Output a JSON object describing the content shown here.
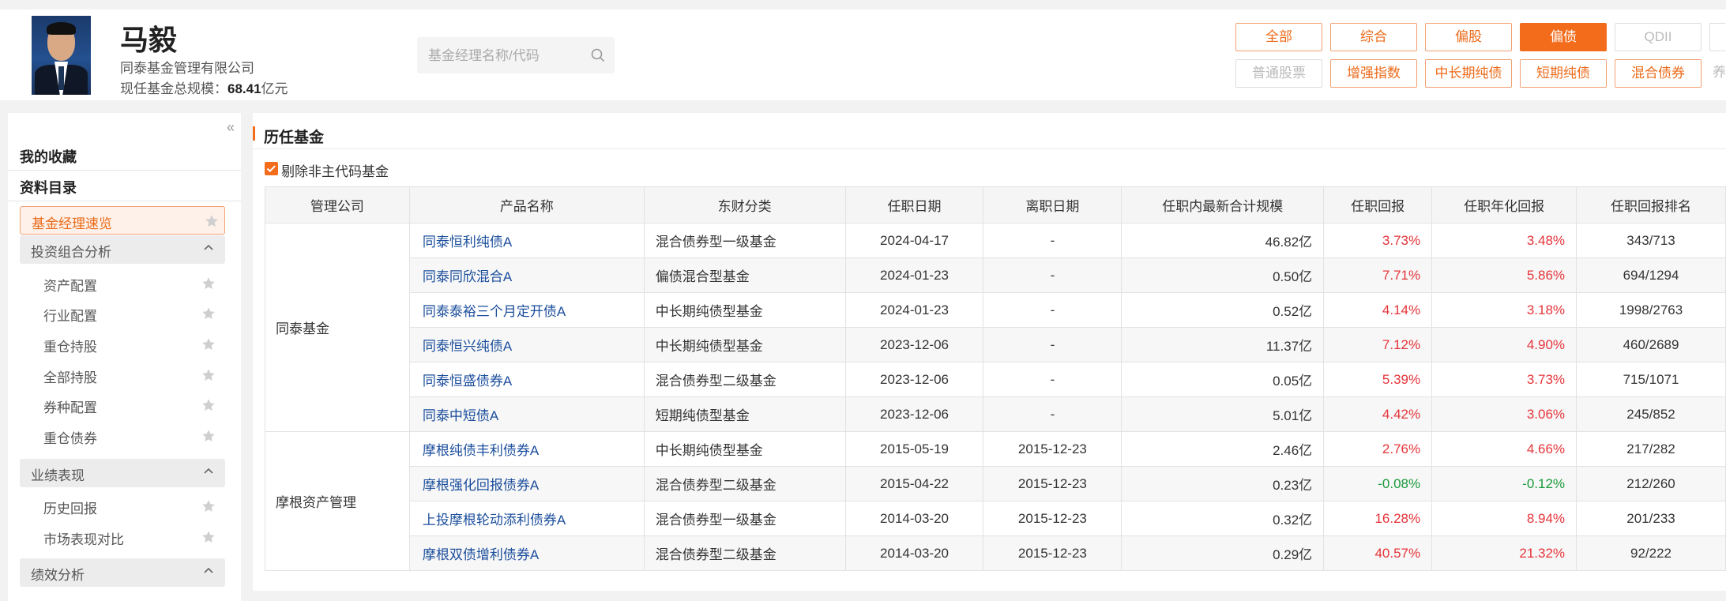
{
  "manager": {
    "name": "马毅",
    "company": "同泰基金管理有限公司",
    "scale_label": "现任基金总规模：",
    "scale_value": "68.41",
    "scale_unit": "亿元"
  },
  "search": {
    "placeholder": "基金经理名称/代码"
  },
  "filters": {
    "row1": [
      "全部",
      "综合",
      "偏股",
      "偏债",
      "QDII"
    ],
    "row2": [
      "普通股票",
      "增强指数",
      "中长期纯债",
      "短期纯债",
      "混合债券",
      "养"
    ],
    "active": "偏债",
    "disabled": [
      "QDII",
      "普通股票"
    ]
  },
  "sidebar": {
    "favorites": "我的收藏",
    "catalog": "资料目录",
    "active_item": "基金经理速览",
    "groups": [
      {
        "label": "投资组合分析",
        "items": [
          "资产配置",
          "行业配置",
          "重仓持股",
          "全部持股",
          "券种配置",
          "重仓债券"
        ]
      },
      {
        "label": "业绩表现",
        "items": [
          "历史回报",
          "市场表现对比"
        ]
      },
      {
        "label": "绩效分析",
        "items": []
      }
    ]
  },
  "main": {
    "title": "历任基金",
    "checkbox_label": "剔除非主代码基金",
    "columns": [
      "管理公司",
      "产品名称",
      "东财分类",
      "任职日期",
      "离职日期",
      "任职内最新合计规模",
      "任职回报",
      "任职年化回报",
      "任职回报排名"
    ],
    "companies": [
      {
        "name": "同泰基金",
        "rows": 6
      },
      {
        "name": "摩根资产管理",
        "rows": 4
      }
    ],
    "rows": [
      {
        "name": "同泰恒利纯债A",
        "category": "混合债券型一级基金",
        "start": "2024-04-17",
        "end": "-",
        "scale": "46.82亿",
        "ret": "3.73%",
        "ann": "3.48%",
        "rank": "343/713"
      },
      {
        "name": "同泰同欣混合A",
        "category": "偏债混合型基金",
        "start": "2024-01-23",
        "end": "-",
        "scale": "0.50亿",
        "ret": "7.71%",
        "ann": "5.86%",
        "rank": "694/1294"
      },
      {
        "name": "同泰泰裕三个月定开债A",
        "category": "中长期纯债型基金",
        "start": "2024-01-23",
        "end": "-",
        "scale": "0.52亿",
        "ret": "4.14%",
        "ann": "3.18%",
        "rank": "1998/2763"
      },
      {
        "name": "同泰恒兴纯债A",
        "category": "中长期纯债型基金",
        "start": "2023-12-06",
        "end": "-",
        "scale": "11.37亿",
        "ret": "7.12%",
        "ann": "4.90%",
        "rank": "460/2689"
      },
      {
        "name": "同泰恒盛债券A",
        "category": "混合债券型二级基金",
        "start": "2023-12-06",
        "end": "-",
        "scale": "0.05亿",
        "ret": "5.39%",
        "ann": "3.73%",
        "rank": "715/1071"
      },
      {
        "name": "同泰中短债A",
        "category": "短期纯债型基金",
        "start": "2023-12-06",
        "end": "-",
        "scale": "5.01亿",
        "ret": "4.42%",
        "ann": "3.06%",
        "rank": "245/852"
      },
      {
        "name": "摩根纯债丰利债券A",
        "category": "中长期纯债型基金",
        "start": "2015-05-19",
        "end": "2015-12-23",
        "scale": "2.46亿",
        "ret": "2.76%",
        "ann": "4.66%",
        "rank": "217/282"
      },
      {
        "name": "摩根强化回报债券A",
        "category": "混合债券型二级基金",
        "start": "2015-04-22",
        "end": "2015-12-23",
        "scale": "0.23亿",
        "ret": "-0.08%",
        "ann": "-0.12%",
        "rank": "212/260"
      },
      {
        "name": "上投摩根轮动添利债券A",
        "category": "混合债券型一级基金",
        "start": "2014-03-20",
        "end": "2015-12-23",
        "scale": "0.32亿",
        "ret": "16.28%",
        "ann": "8.94%",
        "rank": "201/233"
      },
      {
        "name": "摩根双债增利债券A",
        "category": "混合债券型二级基金",
        "start": "2014-03-20",
        "end": "2015-12-23",
        "scale": "0.29亿",
        "ret": "40.57%",
        "ann": "21.32%",
        "rank": "92/222"
      }
    ]
  },
  "colors": {
    "accent": "#f36c1c",
    "positive": "#e5343a",
    "negative": "#1a9a3a",
    "link": "#1a4d9c"
  }
}
